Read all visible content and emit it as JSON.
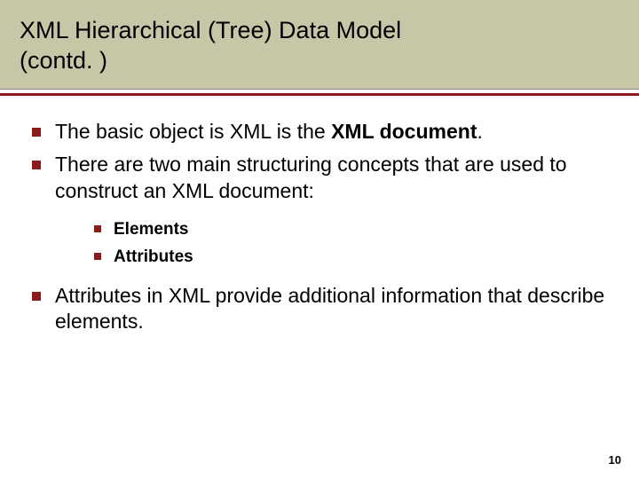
{
  "header": {
    "title_line1": "XML Hierarchical (Tree) Data Model",
    "title_line2": "(contd. )"
  },
  "bullets": {
    "item1_pre": "The basic object is XML is the ",
    "item1_bold": "XML document",
    "item1_post": ".",
    "item2": "There are two main structuring concepts that are used to construct an XML document:",
    "sub1": "Elements",
    "sub2": "Attributes",
    "item3": "Attributes in XML provide additional information that describe elements."
  },
  "page_number": "10"
}
